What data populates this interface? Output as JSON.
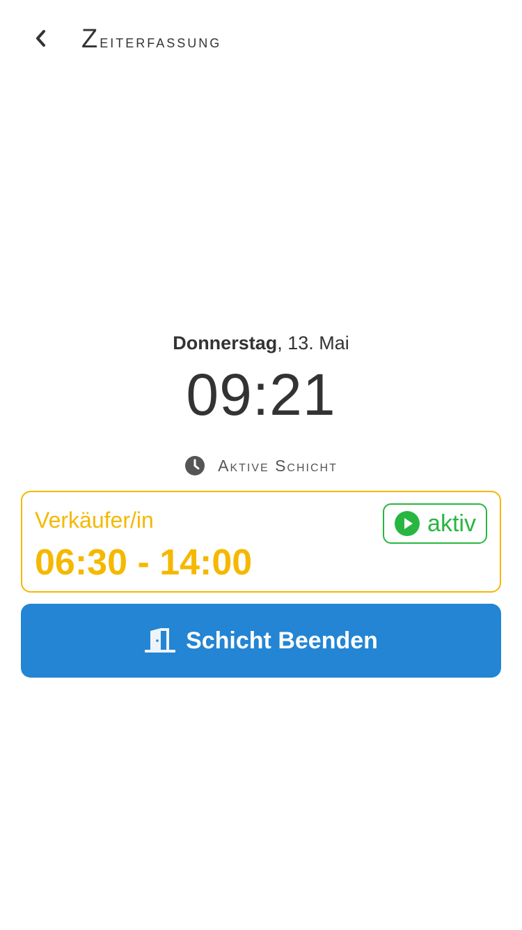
{
  "header": {
    "title": "Zeiterfassung",
    "back_icon": "chevron-left-icon"
  },
  "clock": {
    "weekday": "Donnerstag",
    "date": "13. Mai",
    "time": "09:21"
  },
  "section": {
    "icon": "clock-icon",
    "label": "Aktive Schicht"
  },
  "shift": {
    "role": "Verkäufer/in",
    "time_range": "06:30 - 14:00",
    "status_label": "aktiv",
    "status_icon": "play-circle-icon"
  },
  "actions": {
    "end_shift_label": "Schicht Beenden",
    "end_shift_icon": "door-exit-icon"
  },
  "colors": {
    "accent_yellow": "#f5b800",
    "status_green": "#28b640",
    "primary_blue": "#2385d3",
    "text_dark": "#333333"
  }
}
